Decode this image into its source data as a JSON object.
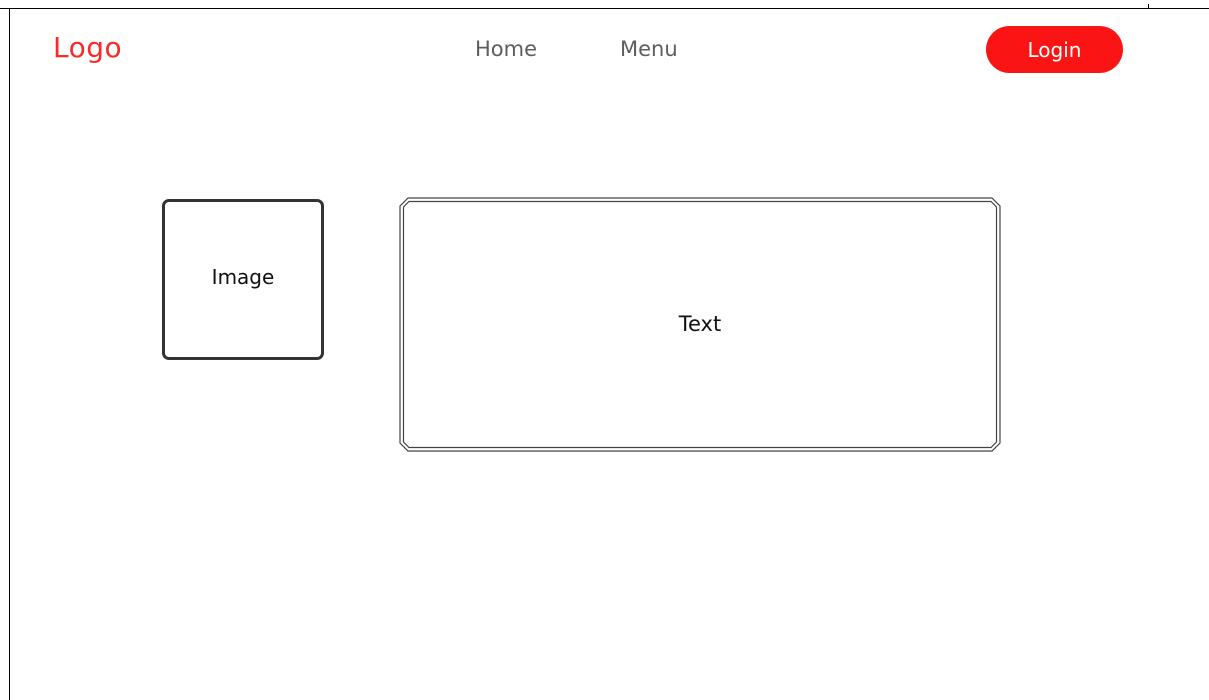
{
  "header": {
    "logo_text": "Logo",
    "nav": {
      "home_label": "Home",
      "menu_label": "Menu"
    },
    "login_label": "Login"
  },
  "main": {
    "image_placeholder_label": "Image",
    "text_placeholder_label": "Text"
  },
  "colors": {
    "accent": "#fa1414",
    "logo": "#fa2a2a",
    "nav_text": "#5e5e5e"
  }
}
